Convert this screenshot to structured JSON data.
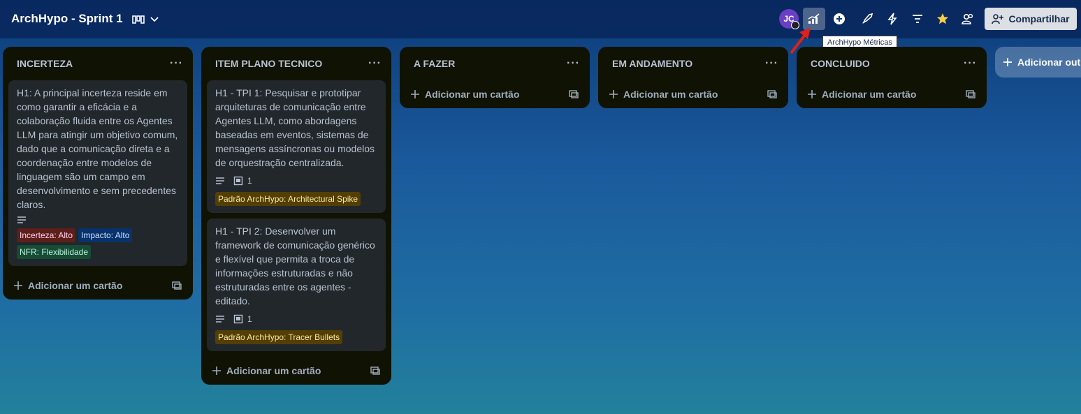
{
  "header": {
    "board_title": "ArchHypo - Sprint 1",
    "avatar_initials": "JC",
    "share_label": "Compartilhar",
    "tooltip": "ArchHypo Métricas"
  },
  "lists": [
    {
      "title": "INCERTEZA",
      "cards": [
        {
          "text": "H1: A principal incerteza reside em como garantir a eficácia e a colaboração fluida entre os Agentes LLM para atingir um objetivo comum, dado que a comunicação direta e a coordenação entre modelos de linguagem são um campo em desenvolvimento e sem precedentes claros.",
          "labels": [
            "Incerteza: Alto",
            "Impacto: Alto",
            "NFR: Flexibilidade"
          ]
        }
      ],
      "add_card": "Adicionar um cartão"
    },
    {
      "title": "ITEM PLANO TECNICO",
      "cards": [
        {
          "text": "H1 - TPI 1: Pesquisar e prototipar arquiteturas de comunicação entre Agentes LLM, como abordagens baseadas em eventos, sistemas de mensagens assíncronas ou modelos de orquestração centralizada.",
          "attachments": "1",
          "labels": [
            "Padrão ArchHypo: Architectural Spike"
          ]
        },
        {
          "text": "H1 - TPI 2: Desenvolver um framework de comunicação genérico e flexível que permita a troca de informações estruturadas e não estruturadas entre os agentes - editado.",
          "attachments": "1",
          "labels": [
            "Padrão ArchHypo: Tracer Bullets"
          ]
        }
      ],
      "add_card": "Adicionar um cartão"
    },
    {
      "title": "A FAZER",
      "add_card": "Adicionar um cartão"
    },
    {
      "title": "EM ANDAMENTO",
      "add_card": "Adicionar um cartão"
    },
    {
      "title": "CONCLUIDO",
      "add_card": "Adicionar um cartão"
    }
  ],
  "add_list_label": "Adicionar out",
  "colors": {
    "list_bg": "#101204",
    "card_bg": "#22272b",
    "label_red": "#5d1f1a",
    "label_blue": "#09326c",
    "label_green": "#164b35",
    "label_yellow": "#533f04"
  }
}
